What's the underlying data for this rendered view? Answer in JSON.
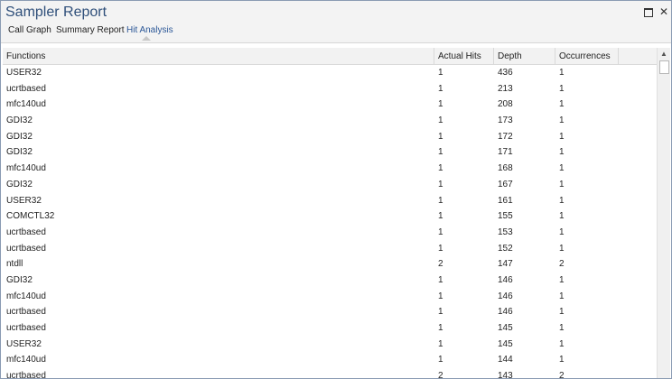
{
  "window": {
    "title": "Sampler Report"
  },
  "tabs": [
    {
      "label": "Call Graph"
    },
    {
      "label": "Summary Report"
    },
    {
      "label": "Hit Analysis"
    }
  ],
  "columns": [
    "Functions",
    "Actual Hits",
    "Depth",
    "Occurrences"
  ],
  "rows": [
    [
      "USER32",
      "1",
      "436",
      "1"
    ],
    [
      "ucrtbased",
      "1",
      "213",
      "1"
    ],
    [
      "mfc140ud",
      "1",
      "208",
      "1"
    ],
    [
      "GDI32",
      "1",
      "173",
      "1"
    ],
    [
      "GDI32",
      "1",
      "172",
      "1"
    ],
    [
      "GDI32",
      "1",
      "171",
      "1"
    ],
    [
      "mfc140ud",
      "1",
      "168",
      "1"
    ],
    [
      "GDI32",
      "1",
      "167",
      "1"
    ],
    [
      "USER32",
      "1",
      "161",
      "1"
    ],
    [
      "COMCTL32",
      "1",
      "155",
      "1"
    ],
    [
      "ucrtbased",
      "1",
      "153",
      "1"
    ],
    [
      "ucrtbased",
      "1",
      "152",
      "1"
    ],
    [
      "ntdll",
      "2",
      "147",
      "2"
    ],
    [
      "GDI32",
      "1",
      "146",
      "1"
    ],
    [
      "mfc140ud",
      "1",
      "146",
      "1"
    ],
    [
      "ucrtbased",
      "1",
      "146",
      "1"
    ],
    [
      "ucrtbased",
      "1",
      "145",
      "1"
    ],
    [
      "USER32",
      "1",
      "145",
      "1"
    ],
    [
      "mfc140ud",
      "1",
      "144",
      "1"
    ],
    [
      "ucrtbased",
      "2",
      "143",
      "2"
    ]
  ],
  "icons": {
    "maximize": "maximize-icon",
    "close": "close-icon",
    "scroll_up": "scroll-up-arrow-icon"
  },
  "colors": {
    "title": "#2f4f7a",
    "active_tab": "#2b5797",
    "border": "#8a9bb3"
  }
}
